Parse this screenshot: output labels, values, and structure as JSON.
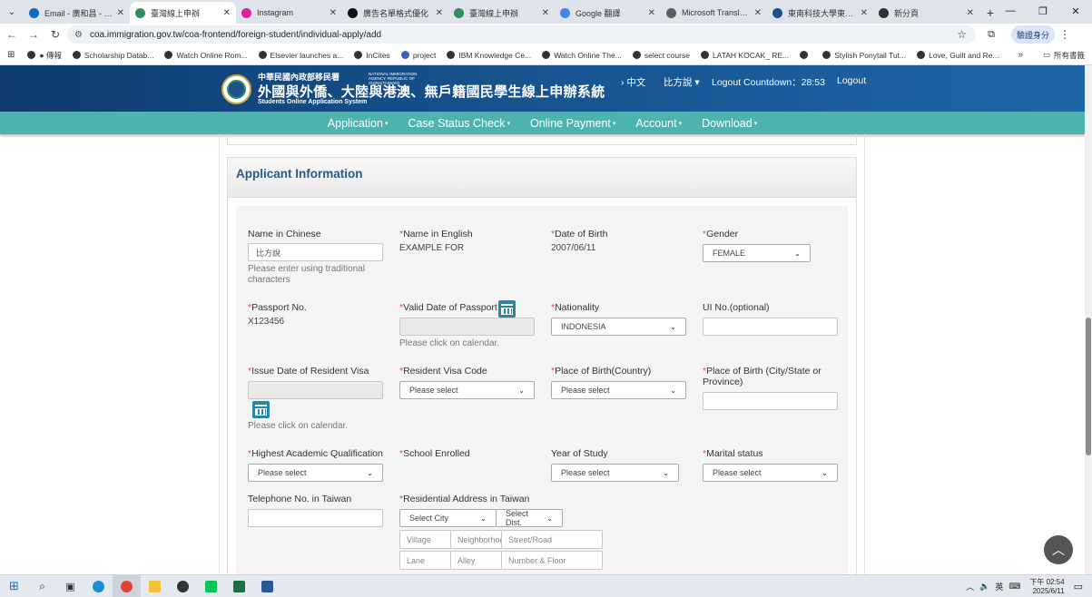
{
  "browser": {
    "tabs": [
      {
        "label": "Email - 廣和昌 - Outl",
        "color": "#0f6cbd"
      },
      {
        "label": "臺灣線上申辦",
        "color": "#2f8f5a",
        "active": true
      },
      {
        "label": "Instagram",
        "color": "#d6249f"
      },
      {
        "label": "廣告名單格式優化",
        "color": "#111111"
      },
      {
        "label": "臺灣線上申辦",
        "color": "#2f8f5a"
      },
      {
        "label": "Google 翻譯",
        "color": "#4285f4"
      },
      {
        "label": "Microsoft Translator",
        "color": "#5e5e5e"
      },
      {
        "label": "東南科技大學東方的",
        "color": "#1f4f8f"
      },
      {
        "label": "新分頁",
        "color": "#333333"
      }
    ],
    "url": "coa.immigration.gov.tw/coa-frontend/foreign-student/individual-apply/add",
    "verify_label": "驗證身分",
    "bookmarks": [
      "● 傳報",
      "Scholarship Datab...",
      "Watch Online Rom...",
      "Elsevier launches a...",
      "InCites",
      "project",
      "IBM Knowledge Ce...",
      "Watch Online The...",
      "select course",
      "LATAH KOCAK_ RE...",
      "",
      "Stylish Ponytail Tut...",
      "Love, Guilt and Re..."
    ],
    "all_bookmarks": "所有書籤"
  },
  "header": {
    "agency_zh": "中華民國內政部移民署",
    "agency_en": "NATIONAL IMMIGRATION AGENCY, REPUBLIC OF CHINA(TAIWAN)",
    "system_zh": "外國與外僑、大陸與港澳、無戶籍國民學生線上申辦系統",
    "system_en": "Students Online Application System",
    "lang_link": "› 中文",
    "user": "比方說 ▾",
    "countdown_label": "Logout Countdown：",
    "countdown_value": "28:53",
    "logout": "Logout"
  },
  "nav": [
    {
      "label": "Application"
    },
    {
      "label": "Case Status Check"
    },
    {
      "label": "Online Payment"
    },
    {
      "label": "Account"
    },
    {
      "label": "Download"
    }
  ],
  "section": {
    "title": "Applicant Information"
  },
  "form": {
    "name_chinese": {
      "label": "Name in Chinese",
      "value": "比方說",
      "hint": "Please enter using traditional characters"
    },
    "name_english": {
      "label": "Name in English",
      "value": "EXAMPLE FOR"
    },
    "dob": {
      "label": "Date of Birth",
      "value": "2007/06/11"
    },
    "gender": {
      "label": "Gender",
      "value": "FEMALE"
    },
    "passport": {
      "label": "Passport No.",
      "value": "X123456"
    },
    "passport_valid": {
      "label": "Valid Date of Passport",
      "hint": "Please click on calendar."
    },
    "nationality": {
      "label": "Nationality",
      "value": "INDONESIA"
    },
    "ui_no": {
      "label": "UI No.(optional)"
    },
    "visa_issue": {
      "label": "Issue Date of Resident Visa",
      "hint": "Please click on calendar."
    },
    "visa_code": {
      "label": "Resident Visa Code",
      "value": "Please select"
    },
    "birth_country": {
      "label": "Place of Birth(Country)",
      "value": "Please select"
    },
    "birth_city": {
      "label": "Place of Birth (City/State or Province)"
    },
    "academic": {
      "label": "Highest Academic Qualification",
      "value": "Please select"
    },
    "school": {
      "label": "School Enrolled"
    },
    "year": {
      "label": "Year of Study",
      "value": "Please select"
    },
    "marital": {
      "label": "Marital status",
      "value": "Please select"
    },
    "phone": {
      "label": "Telephone No. in Taiwan"
    },
    "address": {
      "label": "Residential Address in Taiwan",
      "city": "Select City",
      "dist": "Select Dist.",
      "village": "Village",
      "neighborhood": "Neighborhood",
      "street": "Street/Road",
      "lane": "Lane",
      "alley": "Alley",
      "number": "Number & Floor"
    }
  },
  "taskbar": {
    "ime": "英",
    "time": "下午 02:54",
    "date": "2025/6/11"
  }
}
